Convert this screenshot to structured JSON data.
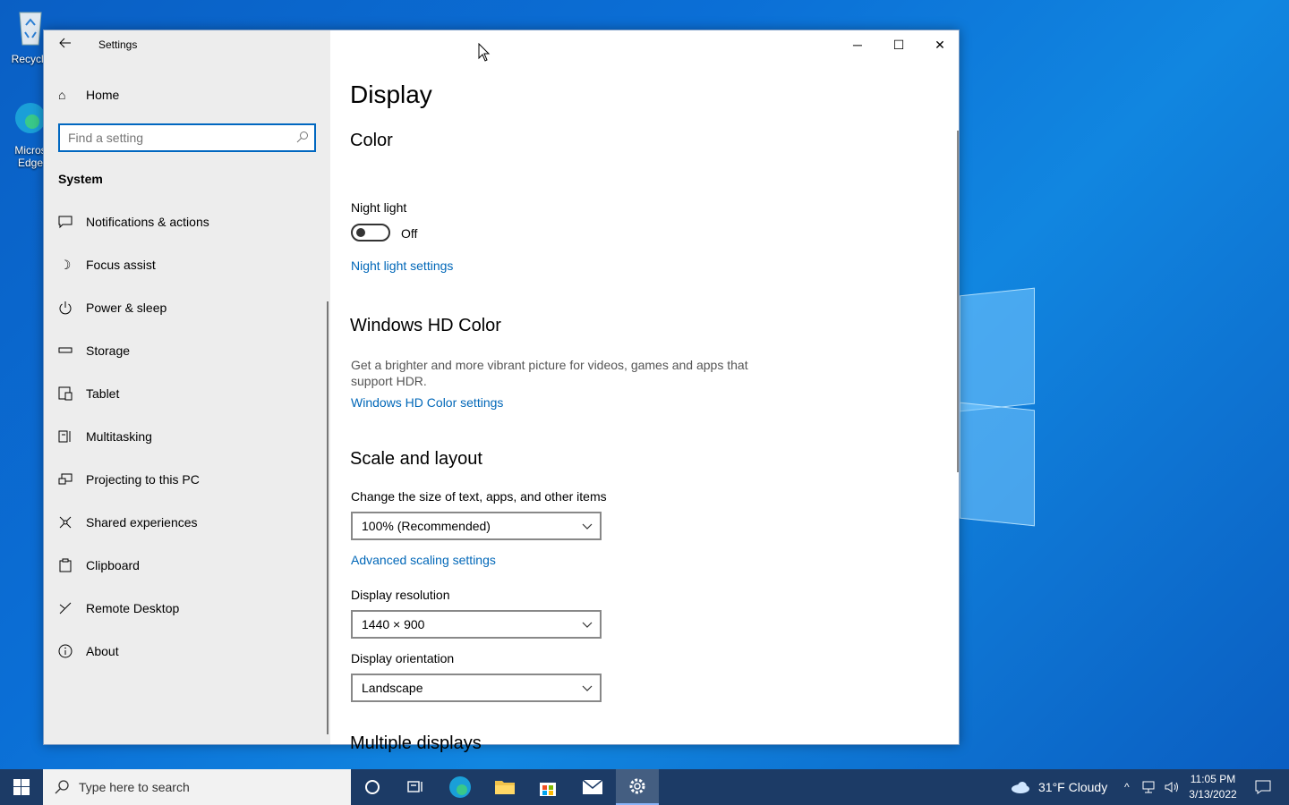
{
  "desktop": {
    "icons": [
      {
        "label": "Recycle"
      },
      {
        "label": "Micros Edge"
      }
    ]
  },
  "window": {
    "app_title": "Settings",
    "controls": {
      "minimize": "─",
      "maximize": "☐",
      "close": "✕"
    }
  },
  "sidebar": {
    "home_label": "Home",
    "search_placeholder": "Find a setting",
    "section": "System",
    "items": [
      {
        "label": "Notifications & actions",
        "icon": "notifications-icon"
      },
      {
        "label": "Focus assist",
        "icon": "moon-icon"
      },
      {
        "label": "Power & sleep",
        "icon": "power-icon"
      },
      {
        "label": "Storage",
        "icon": "storage-icon"
      },
      {
        "label": "Tablet",
        "icon": "tablet-icon"
      },
      {
        "label": "Multitasking",
        "icon": "multitasking-icon"
      },
      {
        "label": "Projecting to this PC",
        "icon": "projecting-icon"
      },
      {
        "label": "Shared experiences",
        "icon": "shared-icon"
      },
      {
        "label": "Clipboard",
        "icon": "clipboard-icon"
      },
      {
        "label": "Remote Desktop",
        "icon": "remote-desktop-icon"
      },
      {
        "label": "About",
        "icon": "info-icon"
      }
    ]
  },
  "content": {
    "title": "Display",
    "color": {
      "heading": "Color",
      "night_light_label": "Night light",
      "night_light_state": "Off",
      "night_light_link": "Night light settings"
    },
    "hd_color": {
      "heading": "Windows HD Color",
      "description": "Get a brighter and more vibrant picture for videos, games and apps that support HDR.",
      "link": "Windows HD Color settings"
    },
    "scale": {
      "heading": "Scale and layout",
      "size_label": "Change the size of text, apps, and other items",
      "size_value": "100% (Recommended)",
      "advanced_link": "Advanced scaling settings",
      "resolution_label": "Display resolution",
      "resolution_value": "1440 × 900",
      "orientation_label": "Display orientation",
      "orientation_value": "Landscape"
    },
    "multiple_heading": "Multiple displays"
  },
  "taskbar": {
    "search_placeholder": "Type here to search",
    "weather": "31°F  Cloudy",
    "time": "11:05 PM",
    "date": "3/13/2022"
  },
  "colors": {
    "accent": "#0067b8",
    "sidebar_bg": "#ededed",
    "taskbar_bg": "#1c3b66"
  }
}
